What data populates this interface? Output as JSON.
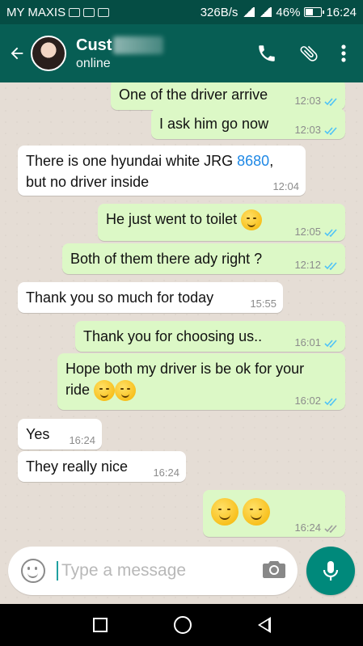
{
  "status_bar": {
    "carrier": "MY MAXIS",
    "speed": "326B/s",
    "battery": "46%",
    "time": "16:24"
  },
  "header": {
    "contact_name": "Cust",
    "contact_status": "online"
  },
  "messages": [
    {
      "text": "One of the driver arrive",
      "time": "12:03",
      "dir": "out"
    },
    {
      "text": "I ask him go now",
      "time": "12:03",
      "dir": "out"
    },
    {
      "text_a": "There is one hyundai white JRG ",
      "link": "8680",
      "text_b": ",",
      "text_line2": "but no driver inside",
      "time": "12:04",
      "dir": "in"
    },
    {
      "text": "He just went to toilet",
      "time": "12:05",
      "dir": "out"
    },
    {
      "text": "Both of them there ady right ?",
      "time": "12:12",
      "dir": "out"
    },
    {
      "text": "Thank you so much for today",
      "time": "15:55",
      "dir": "in"
    },
    {
      "text": "Thank you for choosing us..",
      "time": "16:01",
      "dir": "out"
    },
    {
      "text": "Hope both my driver is be ok for your",
      "text_line2": "ride",
      "time": "16:02",
      "dir": "out"
    },
    {
      "text": "Yes",
      "time": "16:24",
      "dir": "in"
    },
    {
      "text": "They really nice",
      "time": "16:24",
      "dir": "in"
    },
    {
      "text": "",
      "time": "16:24",
      "dir": "out"
    }
  ],
  "composer": {
    "placeholder": "Type a message"
  },
  "icons": {
    "back": "arrow-back-icon",
    "call": "phone-icon",
    "attach": "paperclip-icon",
    "menu": "more-vert-icon",
    "emoji": "emoji-icon",
    "camera": "camera-icon",
    "mic": "mic-icon"
  },
  "colors": {
    "header": "#075e54",
    "outgoing_bubble": "#dcf8c6",
    "incoming_bubble": "#ffffff",
    "read_tick": "#4fc3f7",
    "accent": "#00897b"
  }
}
